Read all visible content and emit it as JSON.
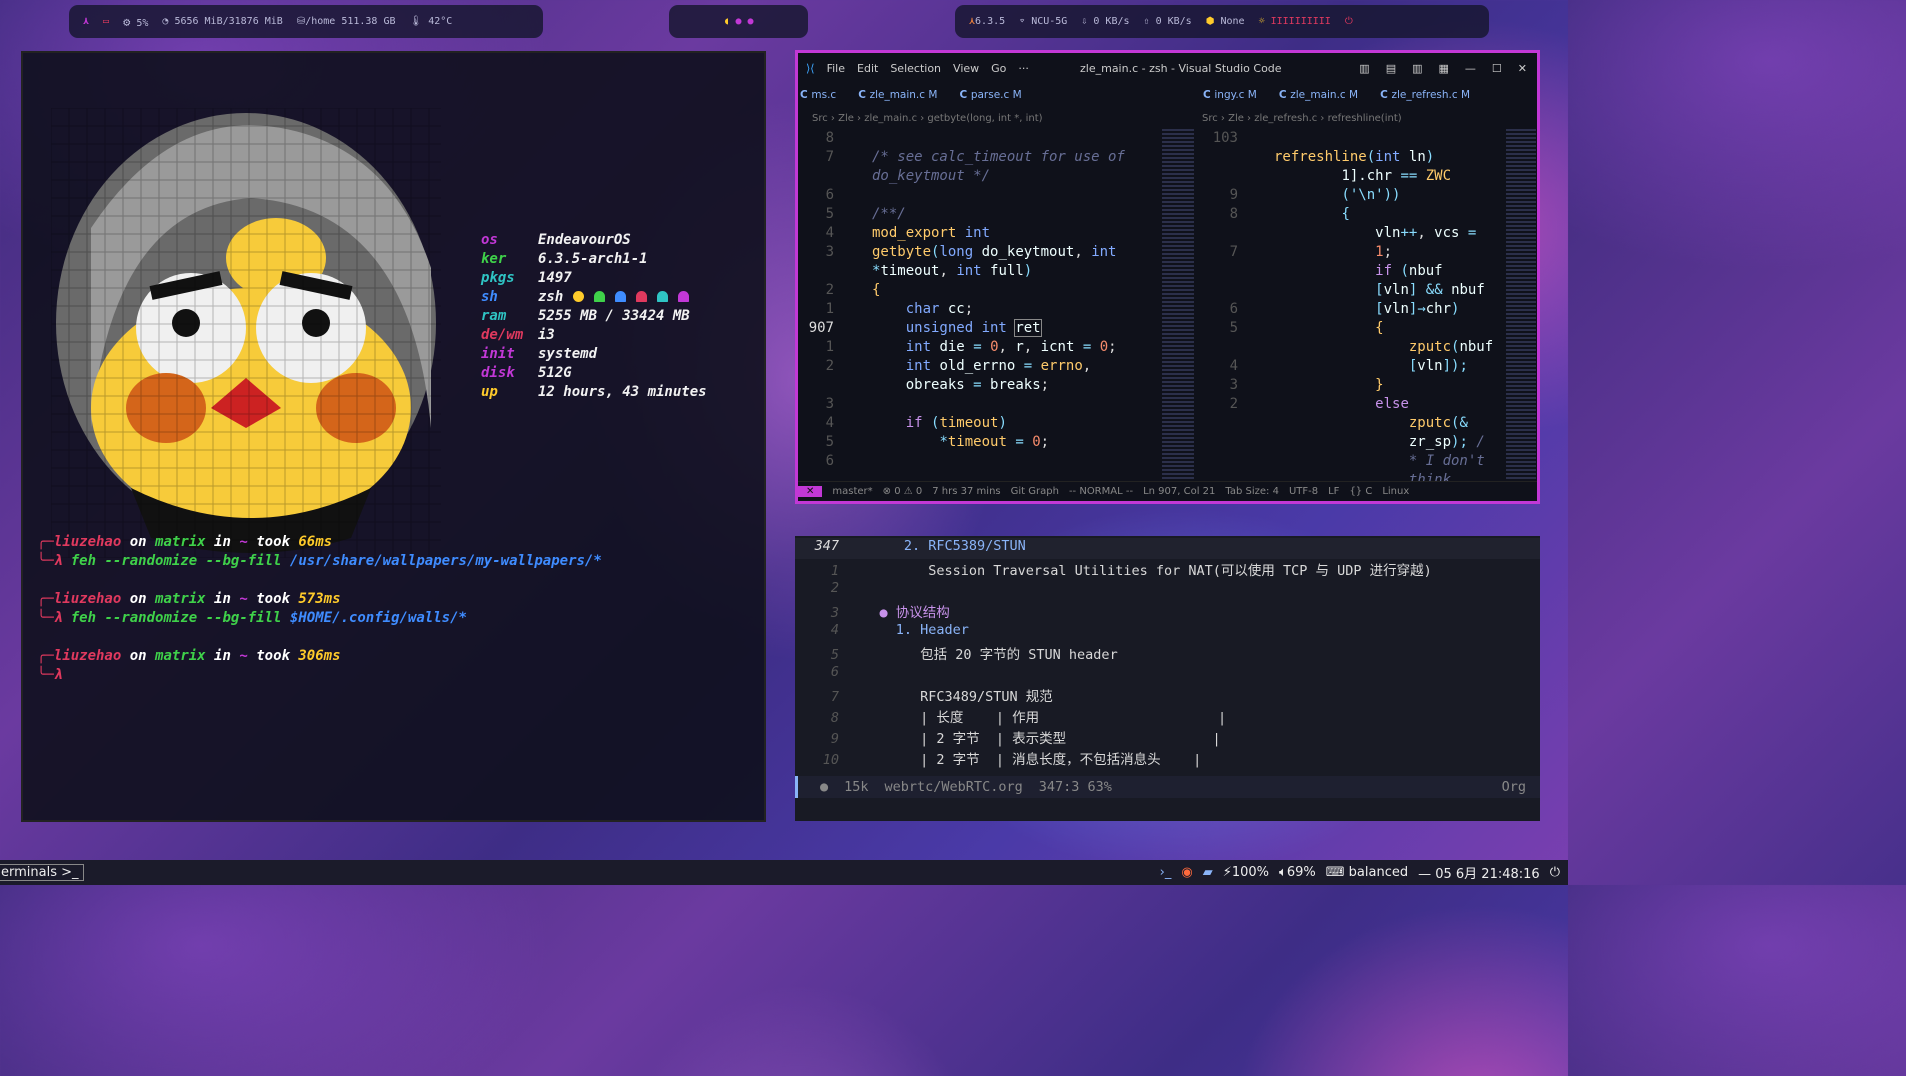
{
  "bar": {
    "left": {
      "logo": "⋏",
      "cpu": "5%",
      "mem": "5656 MiB/31876 MiB",
      "disk": "/home 511.38 GB",
      "temp": "42°C"
    },
    "center": {
      "icons": [
        "pacman-icon",
        "ghost-icon",
        "ghost-icon"
      ]
    },
    "right": {
      "kernel": "6.3.5",
      "wifi": "NCU-5G",
      "down": "0 KB/s",
      "up": "0 KB/s",
      "pkg": "None",
      "brightness": "IIIIIIIIII"
    }
  },
  "fetch": [
    {
      "k": "os",
      "v": "EndeavourOS",
      "c": "#c238d6"
    },
    {
      "k": "ker",
      "v": "6.3.5-arch1-1",
      "c": "#3fd14a"
    },
    {
      "k": "pkgs",
      "v": "1497",
      "c": "#2fc4c4"
    },
    {
      "k": "sh",
      "v": "zsh",
      "c": "#3f8cff"
    },
    {
      "k": "ram",
      "v": "5255 MB / 33424 MB",
      "c": "#2fc4c4"
    },
    {
      "k": "de/wm",
      "v": "i3",
      "c": "#e0395e"
    },
    {
      "k": "init",
      "v": "systemd",
      "c": "#c238d6"
    },
    {
      "k": "disk",
      "v": "512G",
      "c": "#c238d6"
    },
    {
      "k": "up",
      "v": "12 hours, 43 minutes",
      "c": "#ffcb2b"
    }
  ],
  "prompts": [
    {
      "user": "liuzehao",
      "host": "matrix",
      "dir": "~",
      "took": "66ms",
      "cmd": "feh",
      "args": "--randomize --bg-fill",
      "path": "/usr/share/wallpapers/my-wallpapers/*"
    },
    {
      "user": "liuzehao",
      "host": "matrix",
      "dir": "~",
      "took": "573ms",
      "cmd": "feh",
      "args": "--randomize --bg-fill",
      "path": "$HOME/.config/walls/*"
    },
    {
      "user": "liuzehao",
      "host": "matrix",
      "dir": "~",
      "took": "306ms",
      "cmd": "",
      "args": "",
      "path": ""
    }
  ],
  "prompt_words": {
    "on": "on",
    "in": "in",
    "took": "took",
    "lambda": "λ"
  },
  "vscode": {
    "menu": [
      "File",
      "Edit",
      "Selection",
      "View",
      "Go",
      "···"
    ],
    "title": "zle_main.c - zsh - Visual Studio Code",
    "tabs_left": [
      "ms.c",
      "zle_main.c M",
      "parse.c M"
    ],
    "tabs_right": [
      "ingy.c M",
      "zle_main.c M",
      "zle_refresh.c M"
    ],
    "crumb_left": "Src › Zle › zle_main.c › getbyte(long, int *, int)",
    "crumb_right": "Src › Zle › zle_refresh.c › refreshline(int)",
    "status": [
      "master*",
      "⊗ 0 ⚠ 0",
      "7 hrs 37 mins",
      "Git Graph",
      "-- NORMAL --",
      "Ln 907, Col 21",
      "Tab Size: 4",
      "UTF-8",
      "LF",
      "{} C",
      "Linux"
    ]
  },
  "org": {
    "lines": [
      {
        "n": "347",
        "t": "       2. RFC5389/STUN"
      },
      {
        "n": "1",
        "t": "          Session Traversal Utilities for NAT(可以使用 TCP 与 UDP 进行穿越)"
      },
      {
        "n": "2",
        "t": ""
      },
      {
        "n": "3",
        "t": "    ● 协议结构"
      },
      {
        "n": "4",
        "t": "      1. Header"
      },
      {
        "n": "5",
        "t": "         包括 20 字节的 STUN header"
      },
      {
        "n": "6",
        "t": ""
      },
      {
        "n": "7",
        "t": "         RFC3489/STUN 规范"
      },
      {
        "n": "8",
        "t": "         | 长度    | 作用                      |"
      },
      {
        "n": "9",
        "t": "         | 2 字节  | 表示类型                  |"
      },
      {
        "n": "10",
        "t": "         | 2 字节  | 消息长度，不包括消息头    |"
      }
    ],
    "modeline": {
      "size": "15k",
      "file": "webrtc/WebRTC.org",
      "pos": "347:3 63%",
      "mode": "Org"
    }
  },
  "taskbar": {
    "workspace": "erminals >_",
    "battery": "100%",
    "volume": "69%",
    "profile": "balanced",
    "clock": "— 05 6月 21:48:16"
  }
}
